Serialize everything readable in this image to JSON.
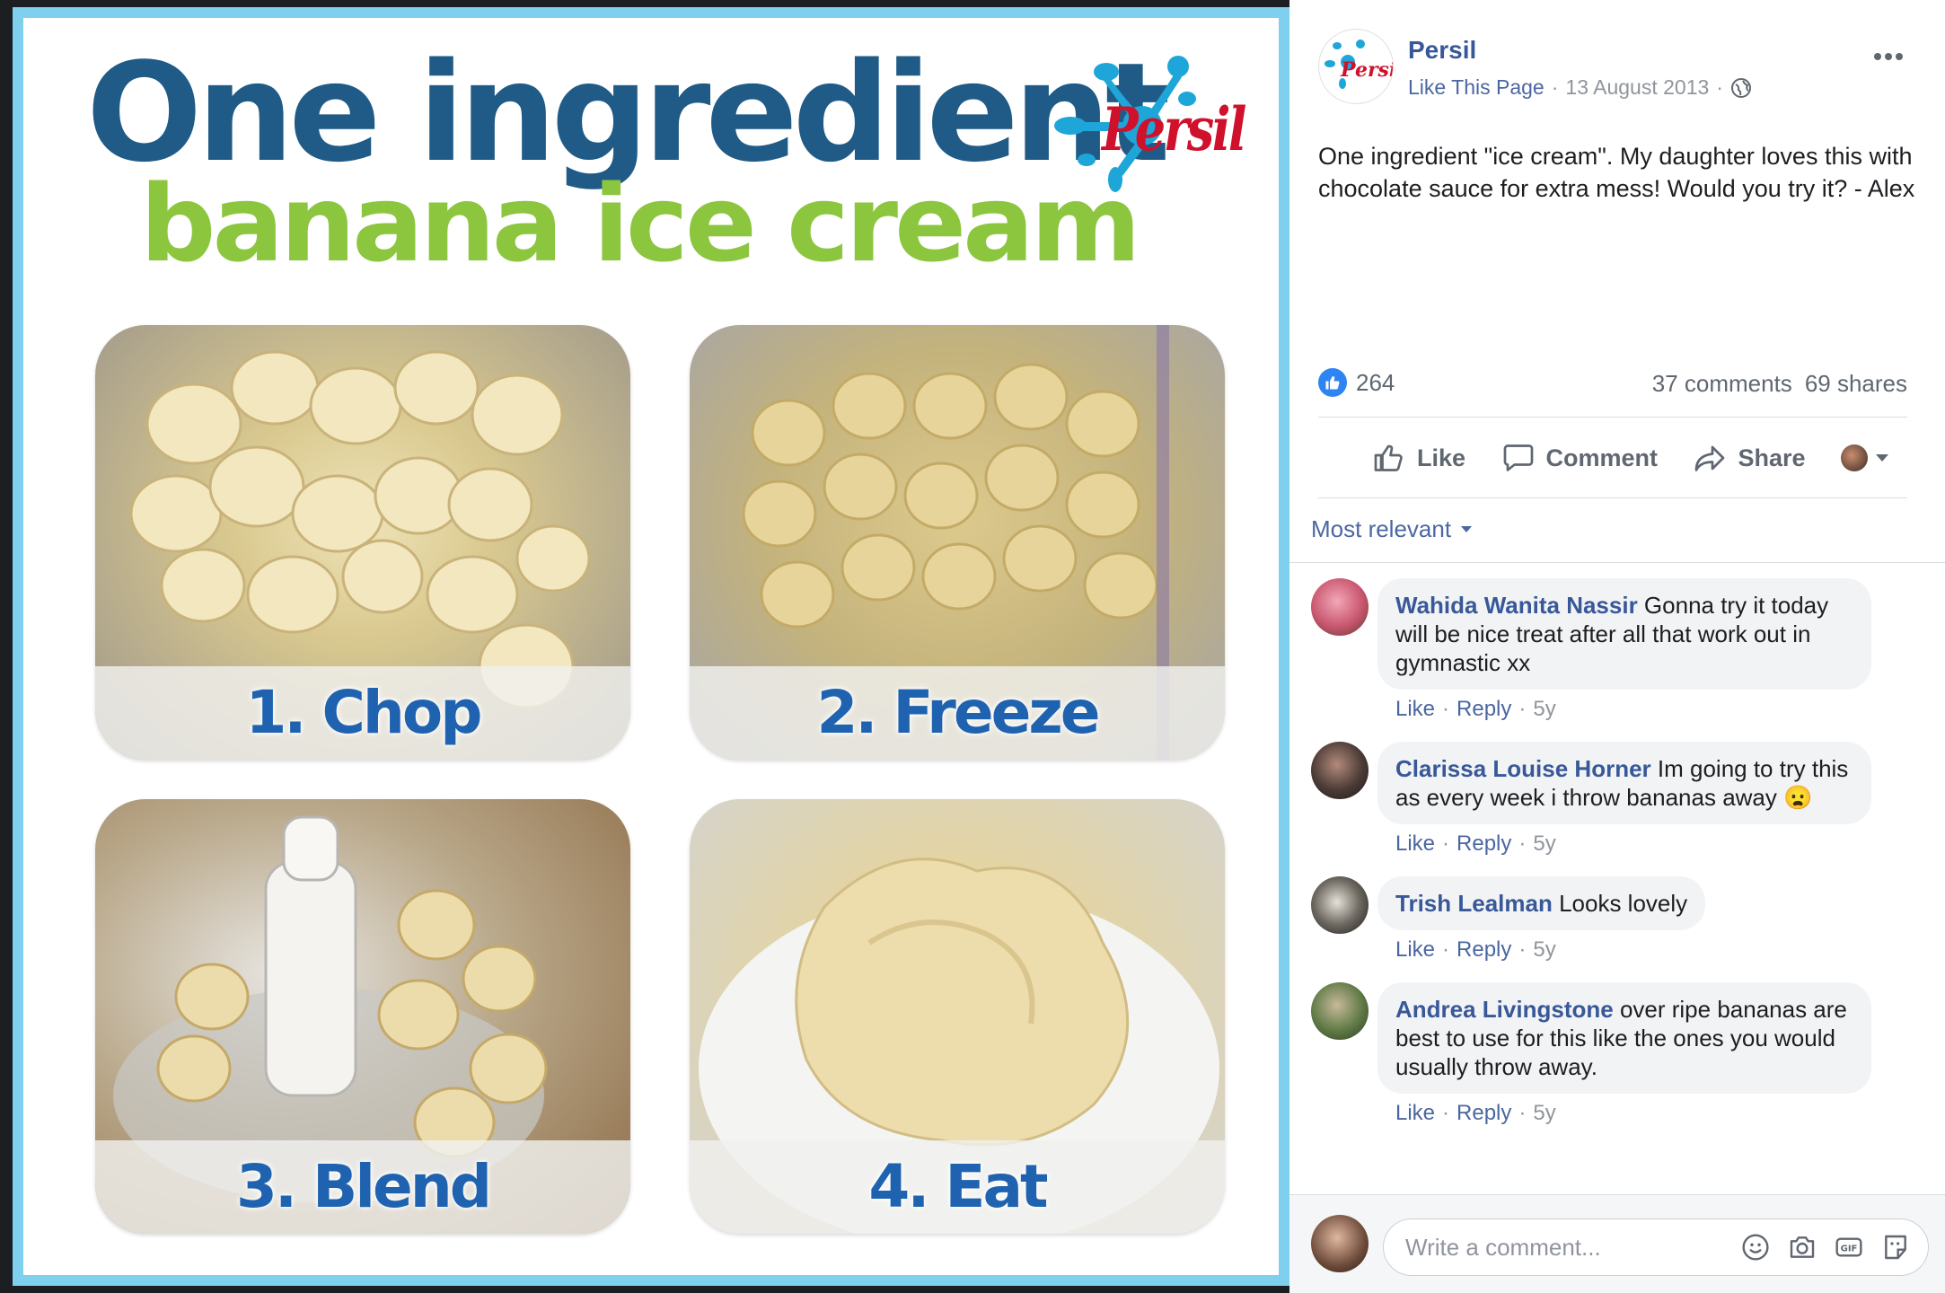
{
  "image": {
    "title_line1": "One ingredient",
    "title_line2": "banana ice cream",
    "brand_logo_text": "Persil",
    "steps": [
      {
        "label": "1. Chop"
      },
      {
        "label": "2. Freeze"
      },
      {
        "label": "3. Blend"
      },
      {
        "label": "4. Eat"
      }
    ]
  },
  "post": {
    "page_name": "Persil",
    "like_page": "Like This Page",
    "date": "13 August 2013",
    "separator": "·",
    "more_icon": "more-horizontal-icon",
    "text": "One ingredient \"ice cream\". My daughter loves this with chocolate sauce for extra mess! Would you try it? - Alex",
    "reaction_count": "264",
    "comments_count": "37 comments",
    "shares_count": "69 shares"
  },
  "actions": {
    "like": "Like",
    "comment": "Comment",
    "share": "Share"
  },
  "sort": {
    "label": "Most relevant"
  },
  "comments": [
    {
      "author": "Wahida Wanita Nassir",
      "text": "Gonna try it today will be nice treat after all that work out in gymnastic xx",
      "like": "Like",
      "reply": "Reply",
      "age": "5y",
      "avatar_color": "#c8566e"
    },
    {
      "author": "Clarissa Louise Horner",
      "text": "Im going to try this as every week i throw bananas away 😦",
      "like": "Like",
      "reply": "Reply",
      "age": "5y",
      "avatar_color": "#4a3b36"
    },
    {
      "author": "Trish Lealman",
      "text": "Looks lovely",
      "like": "Like",
      "reply": "Reply",
      "age": "5y",
      "avatar_color": "#2a2a2a"
    },
    {
      "author": "Andrea Livingstone",
      "text": "over ripe bananas are best to use for this like the ones you would usually throw away.",
      "like": "Like",
      "reply": "Reply",
      "age": "5y",
      "avatar_color": "#5f7a45"
    }
  ],
  "composer": {
    "placeholder": "Write a comment..."
  },
  "colors": {
    "link": "#385898",
    "accent_blue": "#2e84f3",
    "frame": "#7fd0ef",
    "title_blue": "#1f5b86",
    "title_green": "#8cc63f",
    "brand_red": "#d0112b"
  }
}
